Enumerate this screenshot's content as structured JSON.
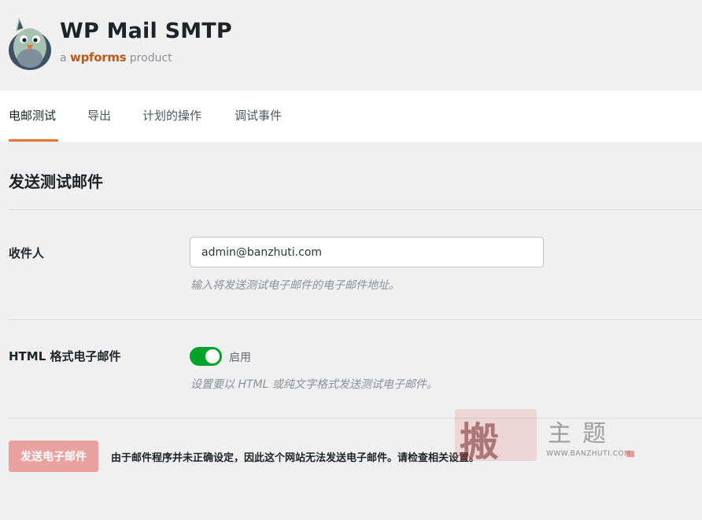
{
  "brand": {
    "title": "WP Mail SMTP",
    "sub_prefix": "a",
    "sub_brand": "wpforms",
    "sub_suffix": "product"
  },
  "tabs": [
    {
      "label": "电邮测试",
      "active": true
    },
    {
      "label": "导出",
      "active": false
    },
    {
      "label": "计划的操作",
      "active": false
    },
    {
      "label": "调试事件",
      "active": false
    }
  ],
  "section": {
    "title": "发送测试邮件"
  },
  "recipient": {
    "label": "收件人",
    "value": "admin@banzhuti.com",
    "description": "输入将发送测试电子邮件的电子邮件地址。"
  },
  "html_format": {
    "label": "HTML 格式电子邮件",
    "toggle_on": true,
    "toggle_label": "启用",
    "description": "设置要以 HTML 或纯文字格式发送测试电子邮件。"
  },
  "send": {
    "button_label": "发送电子邮件",
    "warning": "由于邮件程序并未正确设定，因此这个网站无法发送电子邮件。请检查相关设置。"
  },
  "watermark": {
    "stamp_char": "搬",
    "title": "主题",
    "url": "WWW.BANZHUTI.COM"
  },
  "colors": {
    "accent": "#e27730",
    "toggle_on": "#00a32a",
    "button_disabled": "#e9a2a0"
  }
}
